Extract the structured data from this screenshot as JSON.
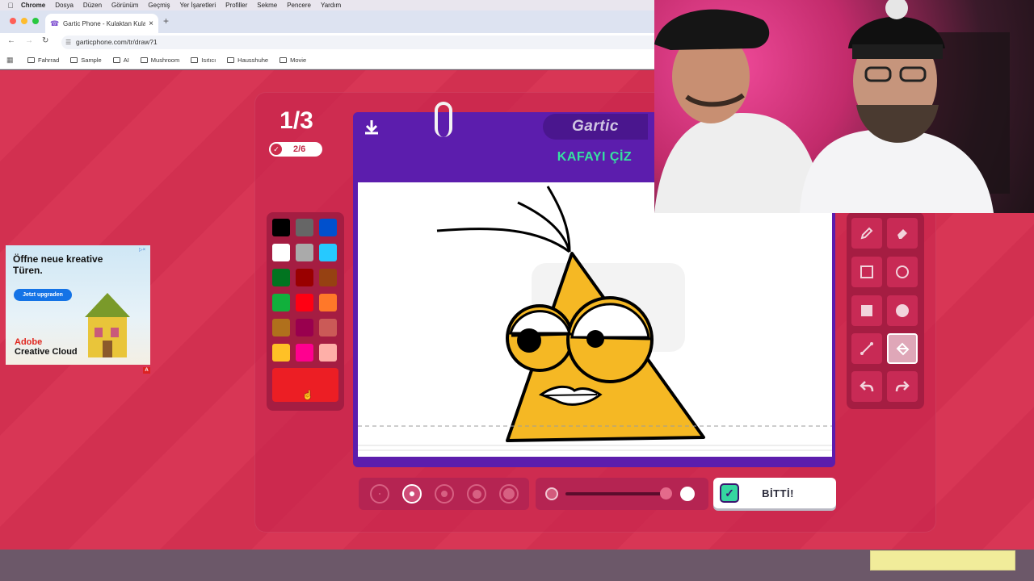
{
  "menubar": {
    "app": "Chrome",
    "items": [
      "Dosya",
      "Düzen",
      "Görünüm",
      "Geçmiş",
      "Yer İşaretleri",
      "Profiller",
      "Sekme",
      "Pencere",
      "Yardım"
    ]
  },
  "browser": {
    "tab_title": "Gartic Phone - Kulaktan Kula",
    "url": "garticphone.com/tr/draw?1"
  },
  "bookmarks": [
    "Fahrrad",
    "Sample",
    "AI",
    "Mushroom",
    "Isıtıcı",
    "Hausshuhe",
    "Movie"
  ],
  "game": {
    "round": "1/3",
    "progress": "2/6",
    "logo": "Gartic",
    "prompt": "KAFAYI ÇİZ",
    "done_label": "BİTTİ!",
    "palette": [
      [
        "#000000",
        "#666666",
        "#0050cd"
      ],
      [
        "#ffffff",
        "#aaaaaa",
        "#26c9ff"
      ],
      [
        "#017420",
        "#990000",
        "#964112"
      ],
      [
        "#11b03c",
        "#ff0013",
        "#ff7829"
      ],
      [
        "#b0701c",
        "#99004e",
        "#cb5a57"
      ],
      [
        "#ffc126",
        "#ff008f",
        "#feafa8"
      ]
    ],
    "selected_color": "#ec1e24",
    "brush_sizes": 5,
    "selected_brush_index": 1,
    "selected_tool": "fill",
    "tools": [
      "pencil",
      "eraser",
      "rectangle-outline",
      "ellipse-outline",
      "rectangle-filled",
      "ellipse-filled",
      "line",
      "fill",
      "undo",
      "redo"
    ]
  },
  "ad": {
    "headline": "Öffne neue kreative Türen.",
    "cta": "Jetzt upgraden",
    "brand_line1": "Adobe",
    "brand_line2": "Creative Cloud",
    "badge": "A"
  }
}
